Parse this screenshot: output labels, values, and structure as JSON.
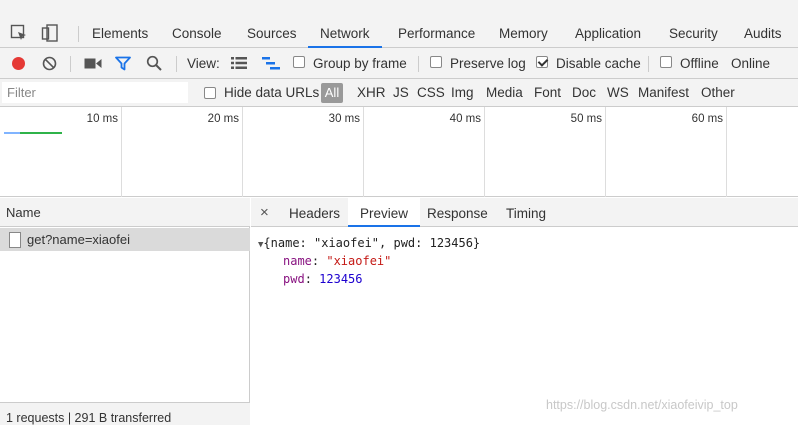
{
  "devtools": {
    "tabs": [
      {
        "label": "Elements"
      },
      {
        "label": "Console"
      },
      {
        "label": "Sources"
      },
      {
        "label": "Network"
      },
      {
        "label": "Performance"
      },
      {
        "label": "Memory"
      },
      {
        "label": "Application"
      },
      {
        "label": "Security"
      },
      {
        "label": "Audits"
      }
    ],
    "active_tab": "Network"
  },
  "toolbar": {
    "view_label": "View:",
    "group_by_frame": {
      "label": "Group by frame",
      "checked": false
    },
    "preserve_log": {
      "label": "Preserve log",
      "checked": false
    },
    "disable_cache": {
      "label": "Disable cache",
      "checked": true
    },
    "offline": {
      "label": "Offline",
      "checked": false
    },
    "throttle": "Online",
    "record_color": "#e53935",
    "filter_icon_color": "#1a73e8"
  },
  "filter_bar": {
    "placeholder": "Filter",
    "hide_data_urls": {
      "label": "Hide data URLs",
      "checked": false
    },
    "types": [
      "All",
      "XHR",
      "JS",
      "CSS",
      "Img",
      "Media",
      "Font",
      "Doc",
      "WS",
      "Manifest",
      "Other"
    ],
    "active_type": "All"
  },
  "timeline": {
    "ticks": [
      "10 ms",
      "20 ms",
      "30 ms",
      "40 ms",
      "50 ms",
      "60 ms"
    ]
  },
  "requests": {
    "header": "Name",
    "items": [
      {
        "name": "get?name=xiaofei"
      }
    ],
    "summary": "1 requests  |  291 B transferred"
  },
  "detail": {
    "close_glyph": "×",
    "tabs": [
      {
        "label": "Headers"
      },
      {
        "label": "Preview"
      },
      {
        "label": "Response"
      },
      {
        "label": "Timing"
      }
    ],
    "active_tab": "Preview",
    "preview": {
      "summary": "{name: \"xiaofei\", pwd: 123456}",
      "fields": [
        {
          "key": "name",
          "value": "\"xiaofei\""
        },
        {
          "key": "pwd",
          "value": "123456"
        }
      ]
    }
  },
  "watermark": "https://blog.csdn.net/xiaofeivip_top"
}
